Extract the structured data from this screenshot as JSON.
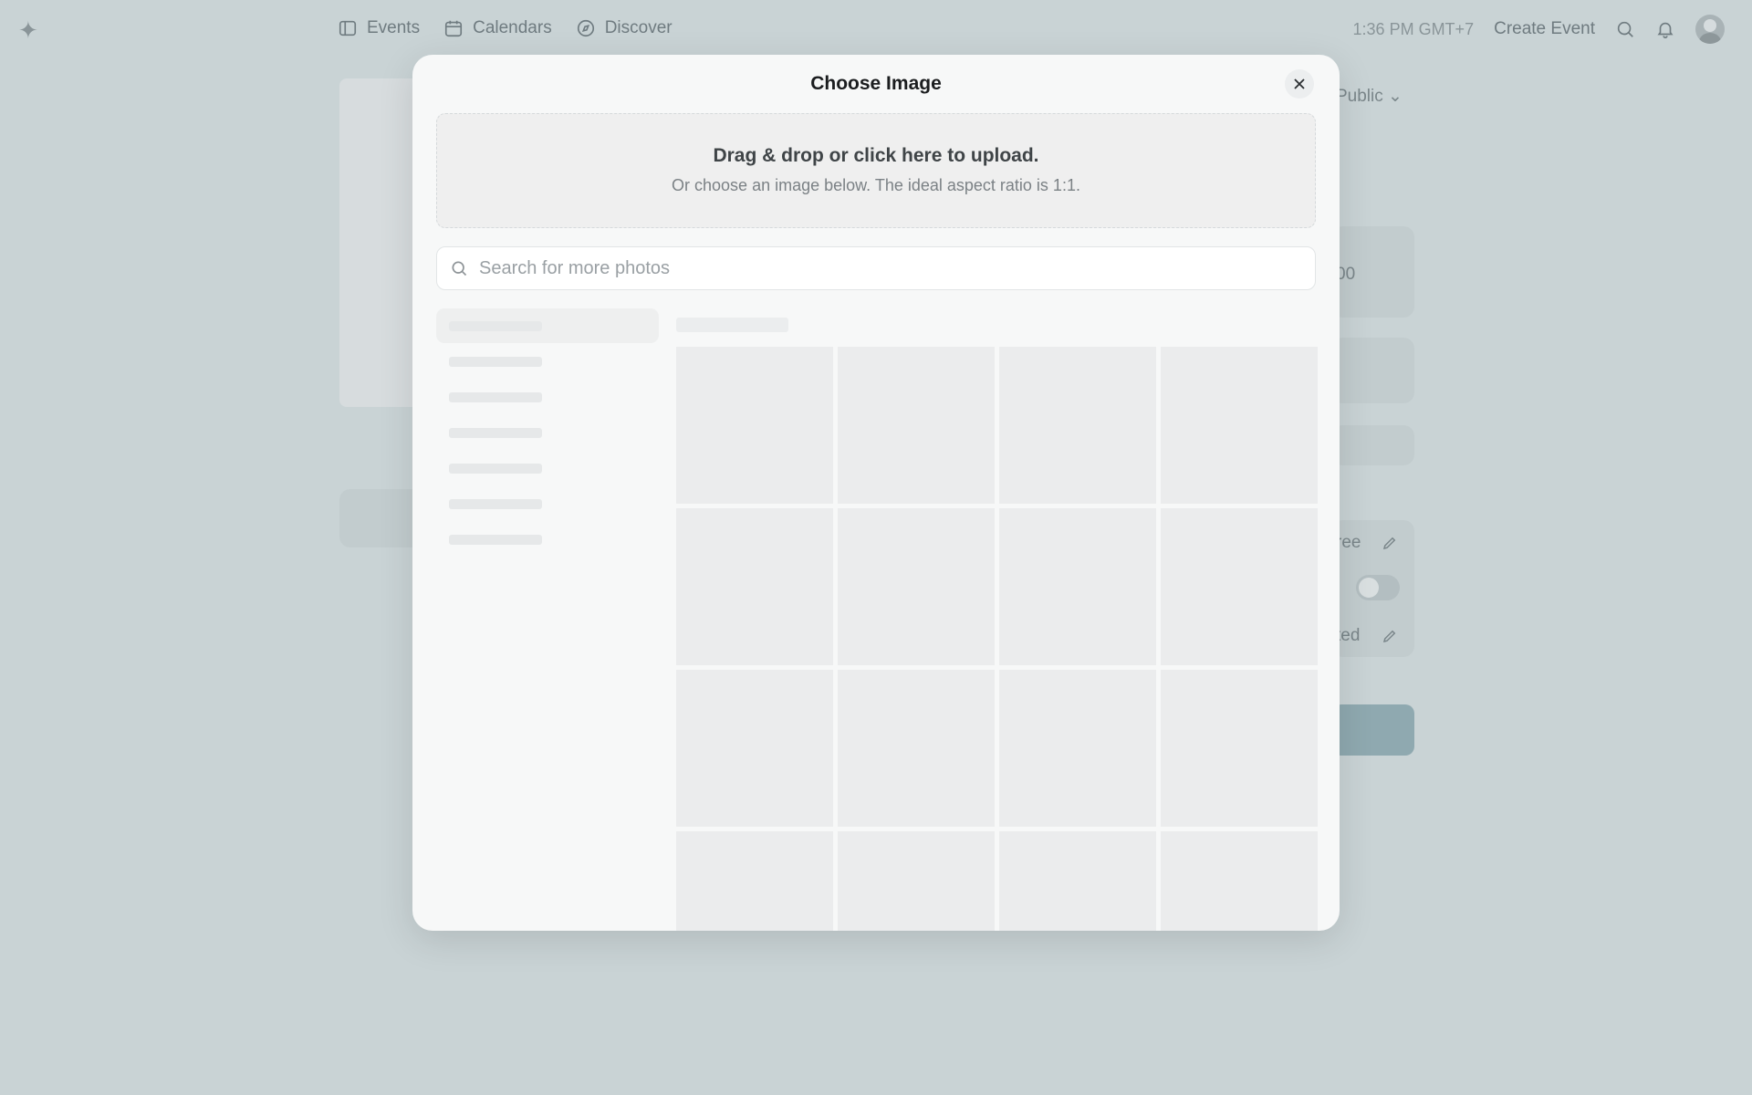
{
  "nav": {
    "logo_icon": "sparkle-icon",
    "links": [
      {
        "label": "Events",
        "icon": "ticket-icon"
      },
      {
        "label": "Calendars",
        "icon": "calendar-icon"
      },
      {
        "label": "Discover",
        "icon": "compass-icon"
      }
    ],
    "time": "1:36 PM GMT+7",
    "create_label": "Create Event"
  },
  "background": {
    "visibility_label": "Public",
    "price_partial": "00",
    "ticket_partial": "ree",
    "capacity_partial": "ted"
  },
  "modal": {
    "title": "Choose Image",
    "dropzone": {
      "title": "Drag & drop or click here to upload.",
      "subtitle": "Or choose an image below. The ideal aspect ratio is 1:1."
    },
    "search": {
      "placeholder": "Search for more photos",
      "value": ""
    },
    "colors": {
      "modal_bg": "#f7f8f8",
      "skeleton": "#ebeced",
      "overlay": "#c9d3d5"
    }
  }
}
